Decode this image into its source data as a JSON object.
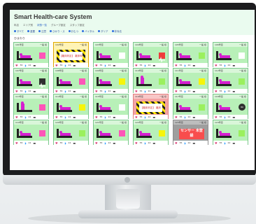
{
  "app": {
    "title": "Smart Health-care System",
    "menu": [
      "年店",
      "エリア別",
      "状態一覧",
      "グループ設定",
      "スタッフ設定"
    ],
    "active_menu": "状態一覧",
    "filters": [
      "すべて",
      "重要",
      "注意",
      "ひかり・ス",
      "おむつ",
      "バイタル",
      "ダリア",
      "非対応"
    ],
    "ward_label": "ひまわり"
  },
  "tiles": [
    {
      "room": "101号室",
      "name": "一般 様",
      "body": "bed",
      "status": "sq-pink",
      "alert": false,
      "heart": 55,
      "lung": 22
    },
    {
      "room": "102号室",
      "name": "一般 様",
      "body": "hazard",
      "hazard_text": "【離床判定】\n離床時",
      "alert": true,
      "heart": 55,
      "lung": 22
    },
    {
      "room": "103号室",
      "name": "一般 様",
      "body": "bed",
      "status": "sq-gray",
      "alert": false,
      "heart": 55,
      "lung": 22
    },
    {
      "room": "104号室",
      "name": "一般 様",
      "body": "bed",
      "status": "sq-red-wave",
      "alert": false,
      "heart": 55,
      "lung": 22
    },
    {
      "room": "105号室",
      "name": "一般 様",
      "body": "bed",
      "status": "sq-green",
      "alert": false,
      "heart": 55,
      "lung": 22
    },
    {
      "room": "106号室",
      "name": "一般 様",
      "body": "bed",
      "status": "sq-gray",
      "alert": false,
      "heart": 55,
      "lung": 22
    },
    {
      "room": "107号室",
      "name": "一般 様",
      "body": "bed",
      "status": "sq-black-wave",
      "alert": false,
      "heart": 55,
      "lung": 22
    },
    {
      "room": "108号室",
      "name": "一般 様",
      "body": "bed",
      "status": "sq-pink",
      "alert": false,
      "heart": 55,
      "lung": 22
    },
    {
      "room": "109号室",
      "name": "一般 様",
      "body": "bed",
      "status": "sq-yellow",
      "alert": false,
      "heart": 55,
      "lung": 22
    },
    {
      "room": "110号室",
      "name": "一般 様",
      "body": "sitting",
      "status": "sq-green",
      "alert": false,
      "heart": 55,
      "lung": 22
    },
    {
      "room": "111号室",
      "name": "一般 様",
      "body": "bed",
      "status": "sq-yellow",
      "alert": false,
      "heart": 55,
      "lung": 22
    },
    {
      "room": "112号室",
      "name": "一般 様",
      "body": "bed",
      "status": "sq-green",
      "alert": false,
      "heart": 55,
      "lung": 22
    },
    {
      "room": "113号室",
      "name": "一般 様",
      "body": "sitting",
      "status": "sq-pink",
      "alert": false,
      "heart": 55,
      "lung": 22
    },
    {
      "room": "114号室",
      "name": "一般 様",
      "body": "bed",
      "status": "sq-yellow",
      "alert": false,
      "heart": 55,
      "lung": 22
    },
    {
      "room": "115号室",
      "name": "一般 様",
      "body": "bed",
      "status": "sq-gray",
      "alert": false,
      "heart": 55,
      "lung": 22
    },
    {
      "room": "116号室",
      "name": "一般 様",
      "body": "hazard",
      "hazard_text": "【離床判定】\n離床",
      "alert": "danger",
      "heart": 55,
      "lung": 22
    },
    {
      "room": "117号室",
      "name": "一般 様",
      "body": "bed",
      "status": "sq-green",
      "alert": false,
      "heart": 55,
      "lung": 22
    },
    {
      "room": "118号室",
      "name": "一般 様",
      "body": "bed",
      "status": "badge",
      "alert": false,
      "heart": 55,
      "lung": 22
    },
    {
      "room": "119号室",
      "name": "一般 様",
      "body": "bed",
      "status": "sq-pink",
      "alert": false,
      "heart": 55,
      "lung": 22
    },
    {
      "room": "120号室",
      "name": "一般 様",
      "body": "bed",
      "status": "sq-green",
      "alert": false,
      "heart": 55,
      "lung": 22
    },
    {
      "room": "121号室",
      "name": "一般 様",
      "body": "bed",
      "status": "sq-pink",
      "alert": false,
      "heart": 55,
      "lung": 22
    },
    {
      "room": "122号室",
      "name": "一般 様",
      "body": "bed",
      "status": "sq-yellow",
      "alert": false,
      "heart": 55,
      "lung": 22
    },
    {
      "room": "123号室",
      "name": "一般 様",
      "body": "no-sensor",
      "no_sensor_text": "センサー\n未登録",
      "alert": "gray",
      "heart": 55,
      "lung": 22
    },
    {
      "room": "124号室",
      "name": "一般 様",
      "body": "bed",
      "status": "sq-green",
      "alert": false,
      "heart": 55,
      "lung": 22
    }
  ],
  "colors": {
    "accent": "#2b63c6",
    "ok": "#b8f0b8",
    "alert": "#fff3b5",
    "danger": "#f4a3a3"
  }
}
